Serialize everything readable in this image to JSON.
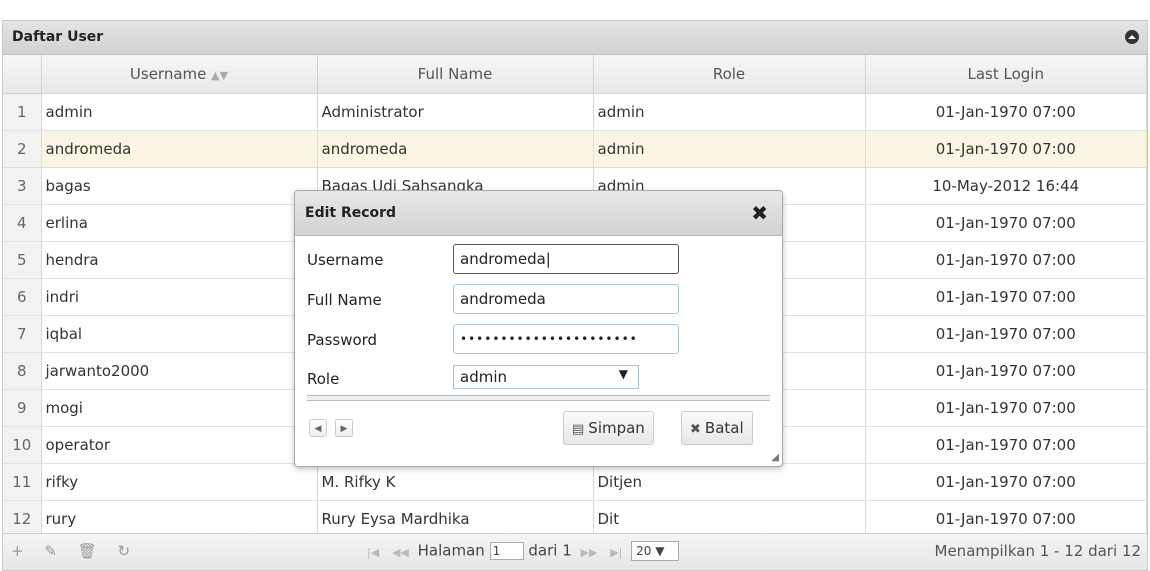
{
  "grid": {
    "title": "Daftar User",
    "columns": [
      "Username",
      "Full Name",
      "Role",
      "Last Login"
    ],
    "sort_indicator": "sort-icon",
    "rows": [
      {
        "n": "1",
        "username": "admin",
        "fullname": "Administrator",
        "role": "admin",
        "last": "01-Jan-1970 07:00"
      },
      {
        "n": "2",
        "username": "andromeda",
        "fullname": "andromeda",
        "role": "admin",
        "last": "01-Jan-1970 07:00"
      },
      {
        "n": "3",
        "username": "bagas",
        "fullname": "Bagas Udi Sahsangka",
        "role": "admin",
        "last": "10-May-2012 16:44"
      },
      {
        "n": "4",
        "username": "erlina",
        "fullname": "",
        "role": "",
        "last": "01-Jan-1970 07:00"
      },
      {
        "n": "5",
        "username": "hendra",
        "fullname": "",
        "role": "",
        "last": "01-Jan-1970 07:00"
      },
      {
        "n": "6",
        "username": "indri",
        "fullname": "",
        "role": "",
        "last": "01-Jan-1970 07:00"
      },
      {
        "n": "7",
        "username": "iqbal",
        "fullname": "",
        "role": "",
        "last": "01-Jan-1970 07:00"
      },
      {
        "n": "8",
        "username": "jarwanto2000",
        "fullname": "",
        "role": "",
        "last": "01-Jan-1970 07:00"
      },
      {
        "n": "9",
        "username": "mogi",
        "fullname": "",
        "role": "",
        "last": "01-Jan-1970 07:00"
      },
      {
        "n": "10",
        "username": "operator",
        "fullname": "",
        "role": "",
        "last": "01-Jan-1970 07:00"
      },
      {
        "n": "11",
        "username": "rifky",
        "fullname": "M. Rifky K",
        "role": "Ditjen",
        "last": "01-Jan-1970 07:00"
      },
      {
        "n": "12",
        "username": "rury",
        "fullname": "Rury Eysa Mardhika",
        "role": "Dit",
        "last": "01-Jan-1970 07:00"
      }
    ]
  },
  "pager": {
    "page_label": "Halaman",
    "page_value": "1",
    "of_label": "dari 1",
    "rows_per_page": "20",
    "info": "Menampilkan 1 - 12 dari 12"
  },
  "dialog": {
    "title": "Edit Record",
    "username_label": "Username",
    "username_value": "andromeda",
    "fullname_label": "Full Name",
    "fullname_value": "andromeda",
    "password_label": "Password",
    "password_value": "••••••••••••••••••••••",
    "role_label": "Role",
    "role_value": "admin",
    "save_label": "Simpan",
    "cancel_label": "Batal"
  }
}
